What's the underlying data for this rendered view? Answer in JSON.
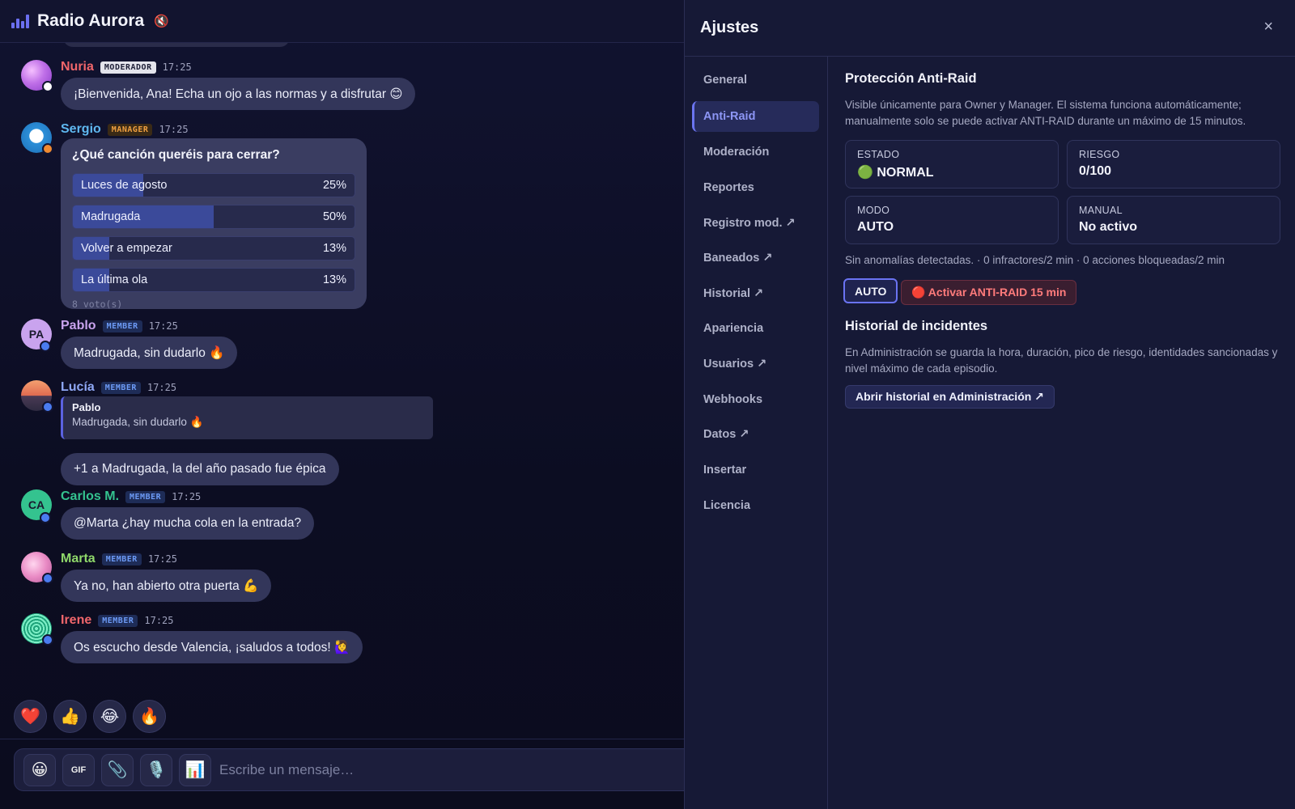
{
  "header": {
    "title": "Radio Aurora",
    "mute_icon": "🔇"
  },
  "messages": [
    {
      "user": "Nuria",
      "role": "MODERADOR",
      "time": "17:25",
      "text": "¡Bienvenida, Ana! Echa un ojo a las normas y a disfrutar 😊"
    },
    {
      "user": "Sergio",
      "role": "MANAGER",
      "time": "17:25"
    },
    {
      "user": "Pablo",
      "initials": "PA",
      "role": "MEMBER",
      "time": "17:25",
      "text": "Madrugada, sin dudarlo 🔥"
    },
    {
      "user": "Lucía",
      "role": "MEMBER",
      "time": "17:25",
      "quote_author": "Pablo",
      "quote_text": "Madrugada, sin dudarlo 🔥",
      "text": "+1 a Madrugada, la del año pasado fue épica"
    },
    {
      "user": "Carlos M.",
      "initials": "CA",
      "role": "MEMBER",
      "time": "17:25",
      "text": "@Marta ¿hay mucha cola en la entrada?"
    },
    {
      "user": "Marta",
      "role": "MEMBER",
      "time": "17:25",
      "text": "Ya no, han abierto otra puerta 💪"
    },
    {
      "user": "Irene",
      "role": "MEMBER",
      "time": "17:25",
      "text": "Os escucho desde Valencia, ¡saludos a todos! 🙋‍♀️"
    }
  ],
  "poll": {
    "question": "¿Qué canción queréis para cerrar?",
    "options": [
      {
        "label": "Luces de agosto",
        "percent": 25,
        "pct": "25%"
      },
      {
        "label": "Madrugada",
        "percent": 50,
        "pct": "50%"
      },
      {
        "label": "Volver a empezar",
        "percent": 13,
        "pct": "13%"
      },
      {
        "label": "La última ola",
        "percent": 13,
        "pct": "13%"
      }
    ],
    "votes": "8 voto(s)"
  },
  "reactions": [
    "❤️",
    "👍",
    "😂",
    "🔥"
  ],
  "composer": {
    "emoji": "😀",
    "gif": "GIF",
    "attach": "📎",
    "mic": "🎙️",
    "poll": "📊",
    "placeholder": "Escribe un mensaje…"
  },
  "settings": {
    "title": "Ajustes",
    "close": "×",
    "nav": [
      "General",
      "Anti-Raid",
      "Moderación",
      "Reportes",
      "Registro mod. ↗",
      "Baneados ↗",
      "Historial ↗",
      "Apariencia",
      "Usuarios ↗",
      "Webhooks",
      "Datos ↗",
      "Insertar",
      "Licencia"
    ],
    "active_nav": "Anti-Raid",
    "antiraid": {
      "title": "Protección Anti-Raid",
      "description": "Visible únicamente para Owner y Manager. El sistema funciona automáticamente; manualmente solo se puede activar ANTI-RAID durante un máximo de 15 minutos.",
      "cards": [
        {
          "key": "ESTADO",
          "value": "🟢 NORMAL"
        },
        {
          "key": "RIESGO",
          "value": "0/100"
        },
        {
          "key": "MODO",
          "value": "AUTO"
        },
        {
          "key": "MANUAL",
          "value": "No activo"
        }
      ],
      "status_line": "Sin anomalías detectadas. · 0 infractores/2 min · 0 acciones bloqueadas/2 min",
      "auto_button": "AUTO",
      "activate_button": "🔴 Activar ANTI-RAID 15 min"
    },
    "incidents": {
      "title": "Historial de incidentes",
      "description": "En Administración se guarda la hora, duración, pico de riesgo, identidades sancionadas y nivel máximo de cada episodio.",
      "button": "Abrir historial en Administración ↗"
    }
  },
  "colors": {
    "accent": "#6b74f0",
    "moderator_name": "#f0666b",
    "manager_name": "#5fb8f0",
    "member_badge": "#6c9af5",
    "danger": "#ff7b7b"
  }
}
